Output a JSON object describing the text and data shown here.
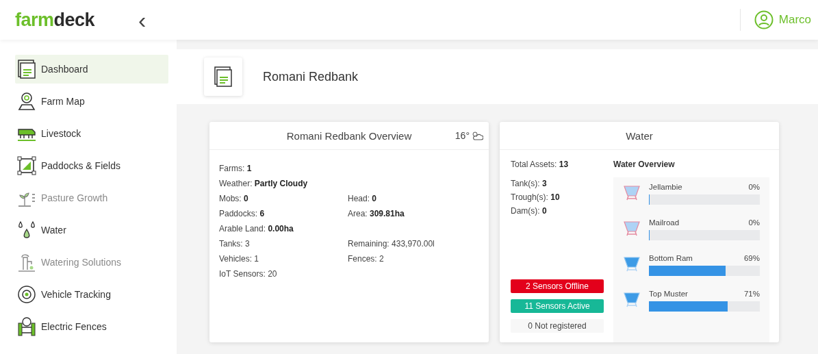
{
  "logo": {
    "brand_start": "farm",
    "brand_end": "deck"
  },
  "collapse_icon": "‹",
  "user": {
    "name": "Marco"
  },
  "sidebar": {
    "items": [
      {
        "label": "Dashboard",
        "selected": true,
        "disabled": false
      },
      {
        "label": "Farm Map",
        "selected": false,
        "disabled": false
      },
      {
        "label": "Livestock",
        "selected": false,
        "disabled": false
      },
      {
        "label": "Paddocks & Fields",
        "selected": false,
        "disabled": false
      },
      {
        "label": "Pasture Growth",
        "selected": false,
        "disabled": true
      },
      {
        "label": "Water",
        "selected": false,
        "disabled": false
      },
      {
        "label": "Watering Solutions",
        "selected": false,
        "disabled": true
      },
      {
        "label": "Vehicle Tracking",
        "selected": false,
        "disabled": false
      },
      {
        "label": "Electric Fences",
        "selected": false,
        "disabled": false
      }
    ]
  },
  "page": {
    "title": "Romani Redbank"
  },
  "overview": {
    "title": "Romani Redbank Overview",
    "temperature": "16°",
    "rows": [
      {
        "left": "Farms: **1**"
      },
      {
        "left": "Weather: **Partly Cloudy**"
      },
      {
        "left": "Mobs: **0**",
        "right": "Head: **0**"
      },
      {
        "left": "Paddocks: **6**",
        "right": "Area: **309.81ha**"
      },
      {
        "left": "Arable Land: **0.00ha**"
      },
      {
        "left": "Tanks: 3",
        "right": "Remaining: 433,970.00l"
      },
      {
        "left": "Vehicles: 1",
        "right": "Fences: 2"
      },
      {
        "left": "IoT Sensors: 20"
      }
    ]
  },
  "water": {
    "title": "Water",
    "total": "Total Assets: **13**",
    "counts": [
      "Tank(s): **3**",
      "Trough(s): **10**",
      "Dam(s): **0**"
    ],
    "sensors": [
      {
        "kind": "offline",
        "label": "2 Sensors Offline"
      },
      {
        "kind": "active",
        "label": "11 Sensors Active"
      },
      {
        "kind": "unregistered",
        "label": "0 Not registered"
      }
    ],
    "overview_title": "Water Overview",
    "assets": [
      {
        "name": "Jellambie",
        "reading": "0%",
        "level": 0
      },
      {
        "name": "Mailroad",
        "reading": "0%",
        "level": 0
      },
      {
        "name": "Bottom Ram",
        "reading": "69%",
        "level": 0.69
      },
      {
        "name": "Top Muster",
        "reading": "71%",
        "level": 0.71
      }
    ]
  }
}
